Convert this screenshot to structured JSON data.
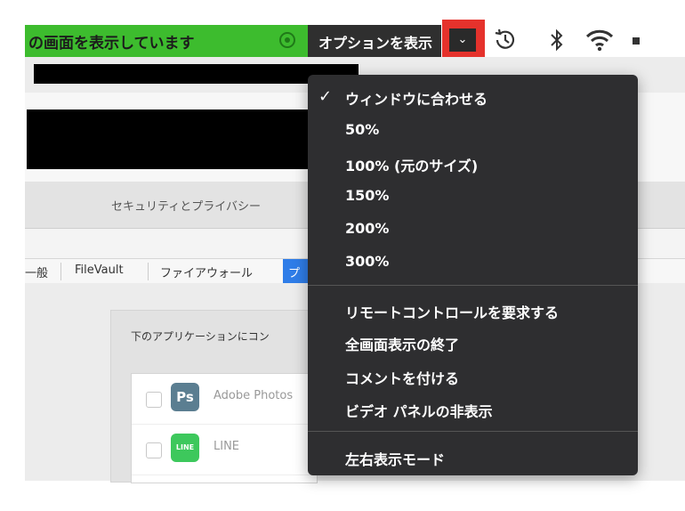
{
  "share_banner": {
    "text": "の画面を表示しています"
  },
  "options": {
    "label": "オプションを表示",
    "dropdown_glyph": "⌄"
  },
  "menubar": {
    "icons": [
      "time-machine-icon",
      "bluetooth-icon",
      "wifi-icon"
    ]
  },
  "prefs": {
    "title": "セキュリティとプライバシー",
    "tabs": [
      "一般",
      "FileVault",
      "ファイアウォール",
      "プ"
    ],
    "panel_text": "下のアプリケーションにコン",
    "apps": [
      {
        "name": "Adobe Photos",
        "icon_text": "Ps",
        "icon_color": "#5b7e91"
      },
      {
        "name": "LINE",
        "icon_text": "LINE",
        "icon_color": "#3dc85c"
      }
    ]
  },
  "menu": {
    "check": "✓",
    "items": [
      "ウィンドウに合わせる",
      "50%",
      "100% (元のサイズ)",
      "150%",
      "200%",
      "300%",
      "リモートコントロールを要求する",
      "全画面表示の終了",
      "コメントを付ける",
      "ビデオ パネルの非表示",
      "左右表示モード"
    ]
  }
}
